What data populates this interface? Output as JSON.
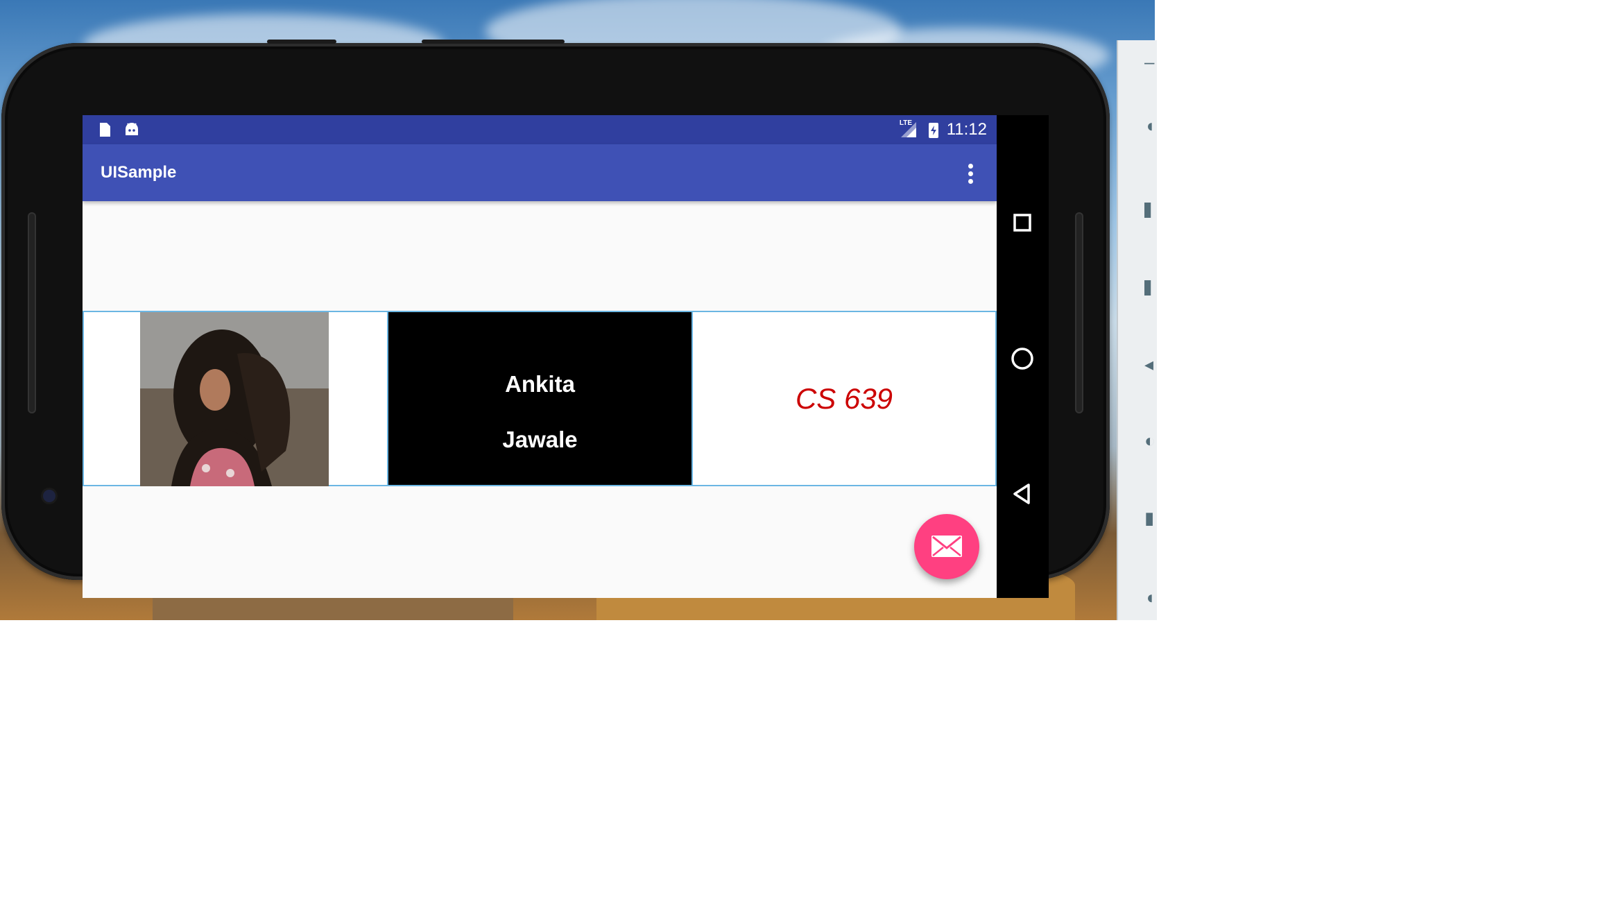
{
  "statusbar": {
    "time": "11:12",
    "network_label": "LTE",
    "icons": [
      "sd-card-icon",
      "android-icon",
      "cell-signal-icon",
      "battery-charging-icon"
    ]
  },
  "appbar": {
    "title": "UISample",
    "menu_icon": "overflow-menu-icon"
  },
  "profile": {
    "photo_icon": "profile-photo",
    "first_name": "Ankita",
    "last_name": "Jawale",
    "course": "CS 639"
  },
  "fab": {
    "icon": "email-icon"
  },
  "navbar": {
    "icons": [
      "recents-square-icon",
      "home-circle-icon",
      "back-triangle-icon"
    ]
  },
  "colors": {
    "status_bar": "#303f9f",
    "app_bar": "#3f51b5",
    "accent": "#ff4081",
    "course_text": "#cc0000",
    "cell_border": "#6bb6e3"
  }
}
